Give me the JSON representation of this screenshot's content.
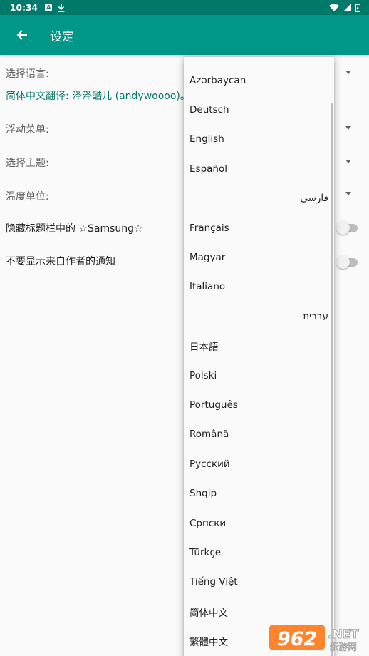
{
  "status_bar": {
    "time": "10:34",
    "left_icons": [
      "notification-a-icon",
      "download-icon"
    ],
    "right_icons": [
      "wifi-icon",
      "signal-icon",
      "battery-icon"
    ]
  },
  "app_bar": {
    "title": "设定",
    "back_icon": "arrow-left-icon"
  },
  "settings": {
    "language_label": "选择语言:",
    "translation_credit": "简体中文翻译: 泽泽酷儿 (andywoooo)。",
    "floating_menu_label": "浮动菜单:",
    "theme_label": "选择主题:",
    "temperature_label": "温度单位:",
    "hide_samsung_label": "隐藏标题栏中的 ☆Samsung☆",
    "hide_samsung_enabled": false,
    "no_author_notify_label": "不要显示来自作者的通知",
    "no_author_notify_enabled": false
  },
  "languages": [
    {
      "label": "Azərbaycan",
      "rtl": false
    },
    {
      "label": "Deutsch",
      "rtl": false
    },
    {
      "label": "English",
      "rtl": false
    },
    {
      "label": "Español",
      "rtl": false
    },
    {
      "label": "فارسی",
      "rtl": true
    },
    {
      "label": "Français",
      "rtl": false
    },
    {
      "label": "Magyar",
      "rtl": false
    },
    {
      "label": "Italiano",
      "rtl": false
    },
    {
      "label": "עברית",
      "rtl": true
    },
    {
      "label": "日本語",
      "rtl": false
    },
    {
      "label": "Polski",
      "rtl": false
    },
    {
      "label": "Português",
      "rtl": false
    },
    {
      "label": "Română",
      "rtl": false
    },
    {
      "label": "Русский",
      "rtl": false
    },
    {
      "label": "Shqip",
      "rtl": false
    },
    {
      "label": "Српски",
      "rtl": false
    },
    {
      "label": "Türkçe",
      "rtl": false
    },
    {
      "label": "Tiếng Việt",
      "rtl": false
    },
    {
      "label": "简体中文",
      "rtl": false
    },
    {
      "label": "繁體中文",
      "rtl": false
    }
  ],
  "watermark": {
    "number": "962",
    "suffix": ".NET",
    "subtitle": "乐游网"
  },
  "colors": {
    "primary": "#009688",
    "primary_dark": "#00796b",
    "accent_text": "#00796b"
  }
}
